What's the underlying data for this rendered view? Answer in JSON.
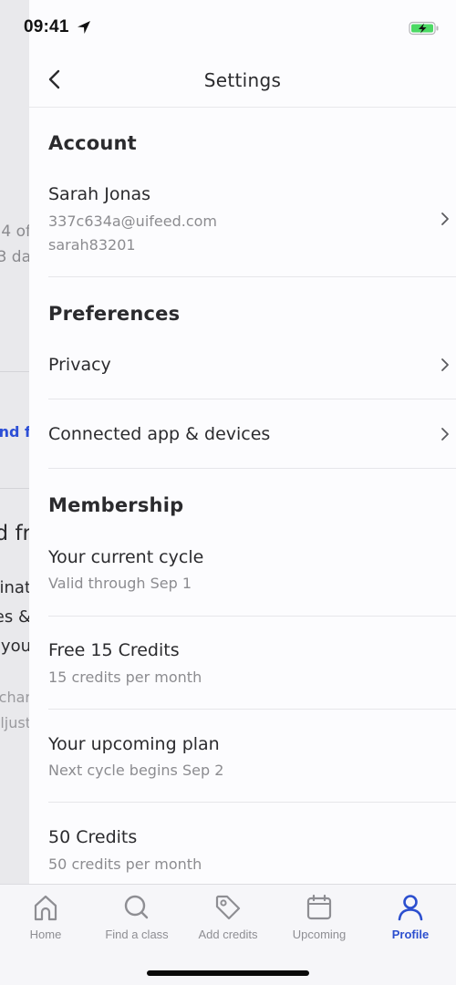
{
  "status_bar": {
    "time": "09:41",
    "location_icon": "location-arrow-icon",
    "battery_icon": "battery-charging-icon",
    "battery_color": "#4cd964"
  },
  "background_screen": {
    "fragments": [
      "4 of",
      "3 da",
      "nd f",
      "d fr",
      "inat",
      "es &",
      "you",
      "char",
      "ljust"
    ]
  },
  "nav": {
    "title": "Settings",
    "back_icon": "chevron-left-icon"
  },
  "sections": {
    "account": {
      "header": "Account",
      "name": "Sarah Jonas",
      "email": "337c634a@uifeed.com",
      "username": "sarah83201"
    },
    "preferences": {
      "header": "Preferences",
      "items": [
        {
          "label": "Privacy"
        },
        {
          "label": "Connected app & devices"
        }
      ]
    },
    "membership": {
      "header": "Membership",
      "items": [
        {
          "title": "Your current cycle",
          "subtitle": "Valid through Sep 1"
        },
        {
          "title": "Free 15 Credits",
          "subtitle": "15 credits per month"
        },
        {
          "title": "Your upcoming plan",
          "subtitle": "Next cycle begins Sep 2"
        },
        {
          "title": "50 Credits",
          "subtitle": "50 credits per month"
        }
      ]
    }
  },
  "tab_bar": {
    "active_color": "#2c4fcf",
    "inactive_color": "#8e8e93",
    "tabs": [
      {
        "label": "Home",
        "icon": "home-icon",
        "active": false
      },
      {
        "label": "Find a class",
        "icon": "search-icon",
        "active": false
      },
      {
        "label": "Add credits",
        "icon": "tag-icon",
        "active": false
      },
      {
        "label": "Upcoming",
        "icon": "calendar-icon",
        "active": false
      },
      {
        "label": "Profile",
        "icon": "person-icon",
        "active": true
      }
    ]
  }
}
